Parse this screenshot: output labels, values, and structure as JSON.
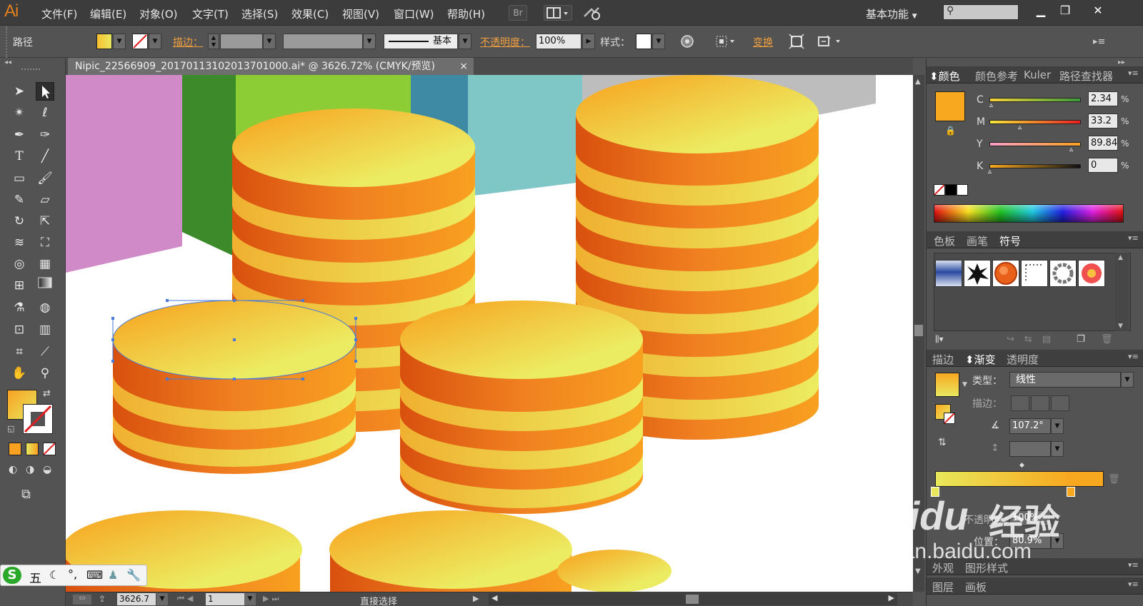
{
  "app": {
    "logo": "Ai",
    "bridge": "Br",
    "workspace": "基本功能"
  },
  "menu": [
    "文件(F)",
    "编辑(E)",
    "对象(O)",
    "文字(T)",
    "选择(S)",
    "效果(C)",
    "视图(V)",
    "窗口(W)",
    "帮助(H)"
  ],
  "control": {
    "object_type": "路径",
    "stroke_label": "描边：",
    "brush": "基本",
    "opacity_label": "不透明度：",
    "opacity": "100%",
    "style_label": "样式：",
    "transform_label": "变换"
  },
  "document": {
    "tab_title": "Nipic_22566909_20170113102013701000.ai* @ 3626.72% (CMYK/预览)",
    "close": "×"
  },
  "status": {
    "zoom": "3626.7",
    "page": "1",
    "tool": "直接选择"
  },
  "color_panel": {
    "tabs": [
      "颜色",
      "颜色参考",
      "Kuler",
      "路径查找器"
    ],
    "channels": [
      {
        "label": "C",
        "value": "2.34"
      },
      {
        "label": "M",
        "value": "33.2"
      },
      {
        "label": "Y",
        "value": "89.84"
      },
      {
        "label": "K",
        "value": "0"
      }
    ],
    "pct": "%",
    "fill_color": "#f8a81f"
  },
  "symbols_panel": {
    "tabs": [
      "色板",
      "画笔",
      "符号"
    ]
  },
  "gradient_panel": {
    "tabs": [
      "描边",
      "渐变",
      "透明度"
    ],
    "type_label": "类型：",
    "type": "线性",
    "stroke_label": "描边：",
    "angle": "107.2°",
    "opacity_label": "不透明度：",
    "opacity": "100%",
    "position_label": "位置：",
    "position": "80.9%",
    "stop1": "#e8e85a",
    "stop2": "#f8a81f"
  },
  "bottom_panels": {
    "tabs1": [
      "外观",
      "图形样式"
    ],
    "tabs2": [
      "图层",
      "画板"
    ]
  },
  "ime": {
    "mode": "五"
  },
  "watermark": {
    "brand": "Baidu",
    "brand_cn": "经验",
    "url": "jingyan.baidu.com"
  }
}
